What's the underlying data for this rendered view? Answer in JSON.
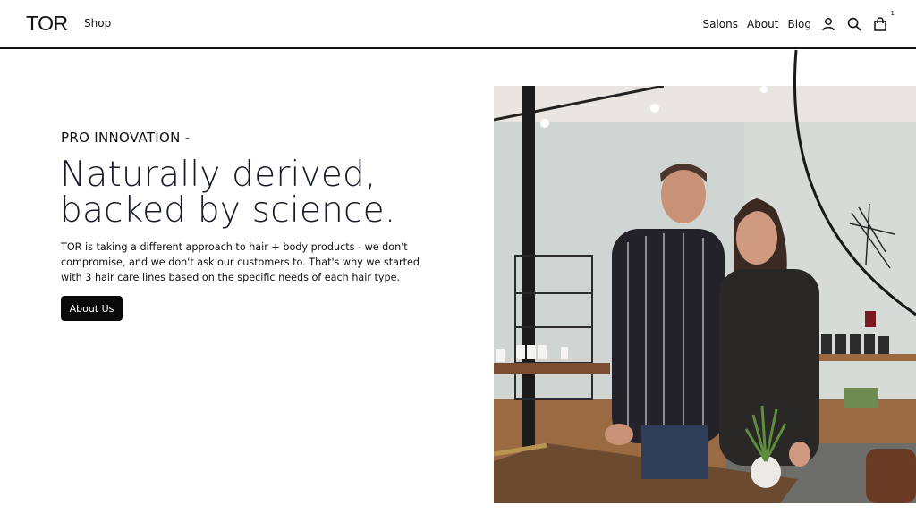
{
  "header": {
    "logo": "TOR",
    "shop_label": "Shop",
    "nav": [
      {
        "label": "Salons"
      },
      {
        "label": "About"
      },
      {
        "label": "Blog"
      }
    ],
    "icons": [
      "account-icon",
      "search-icon",
      "bag-icon"
    ],
    "cart_count": "1"
  },
  "hero": {
    "eyebrow": "PRO INNOVATION -",
    "headline_line1": "Naturally derived,",
    "headline_line2": "backed by science.",
    "body": "TOR is taking a different approach to hair + body products - we don't compromise, and we don't ask our customers to. That's why we started with 3 hair care lines based on the specific needs of each hair type.",
    "cta_label": "About Us"
  },
  "colors": {
    "text": "#111111",
    "headline": "#161a2a",
    "button_bg": "#0a0a0a",
    "button_text": "#ffffff",
    "background": "#ffffff"
  }
}
